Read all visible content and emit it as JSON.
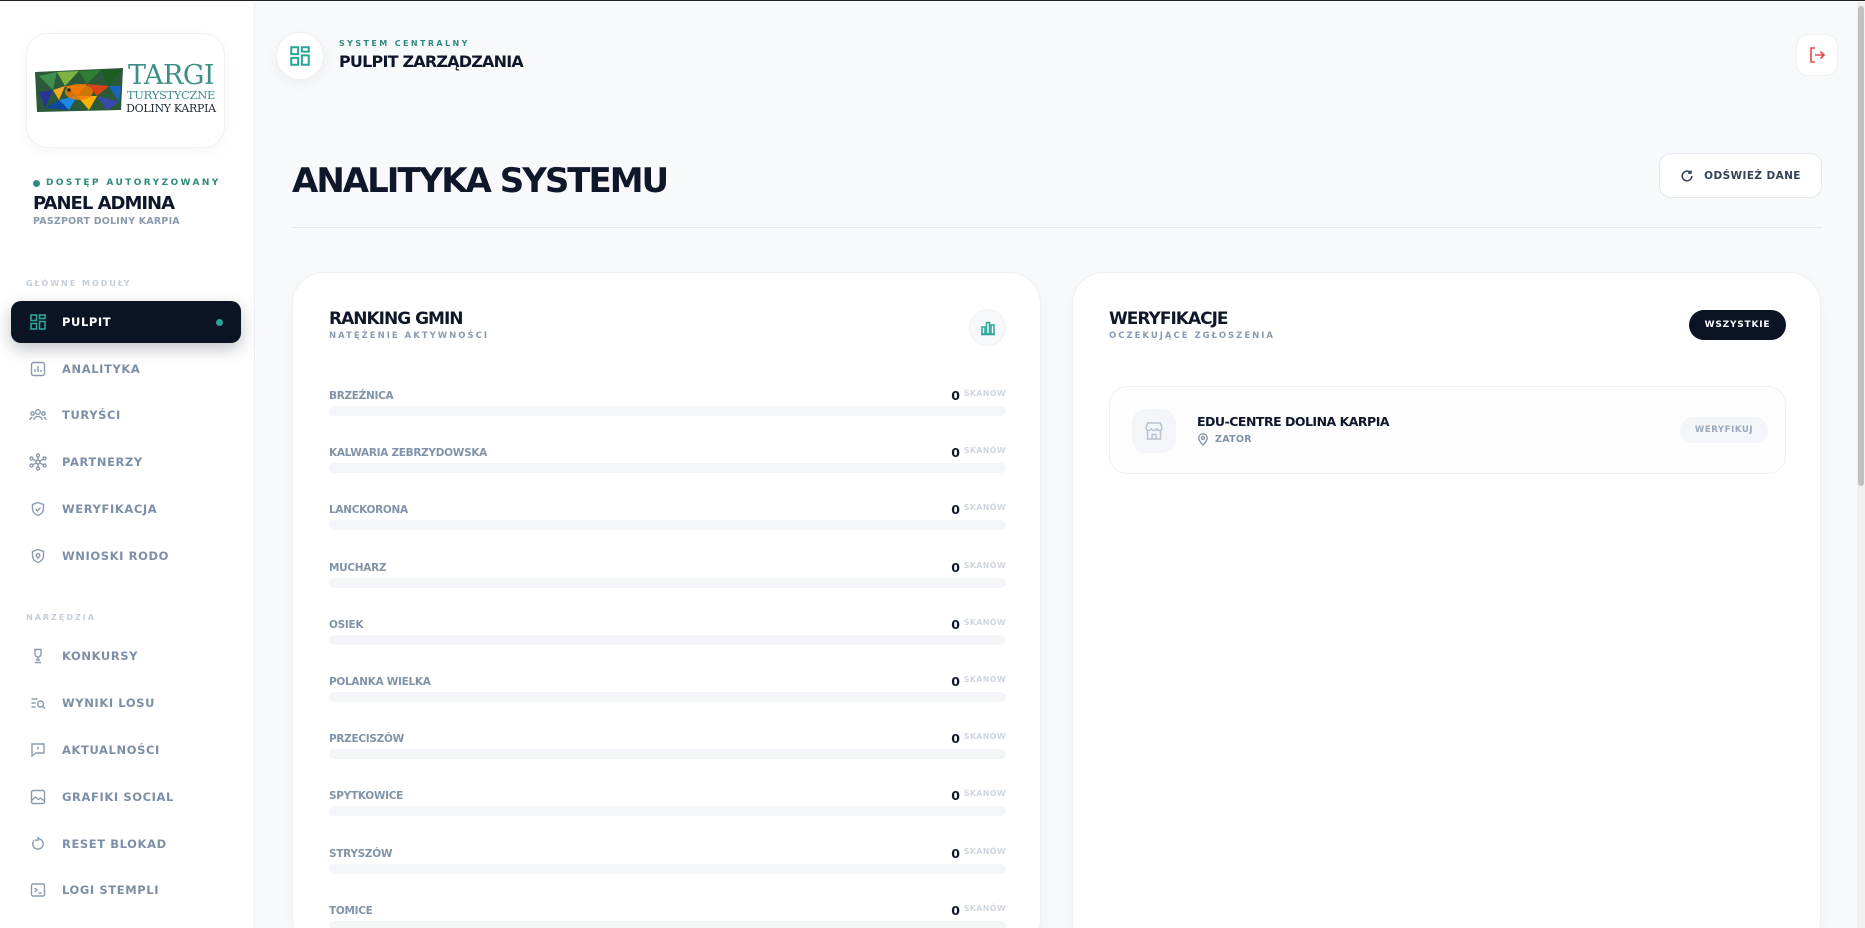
{
  "sidebar": {
    "logo": {
      "line1": "TARGI",
      "line2": "TURYSTYCZNE",
      "line3": "DOLINY KARPIA"
    },
    "auth_label": "DOSTĘP AUTORYZOWANY",
    "title": "PANEL ADMINA",
    "subtitle": "PASZPORT DOLINY KARPIA",
    "section_main": "GŁÓWNE MODUŁY",
    "section_tools": "NARZĘDZIA",
    "items": [
      {
        "label": "PULPIT",
        "icon": "grid-icon",
        "active": true
      },
      {
        "label": "ANALITYKA",
        "icon": "chart-icon"
      },
      {
        "label": "TURYŚCI",
        "icon": "users-icon"
      },
      {
        "label": "PARTNERZY",
        "icon": "network-icon"
      },
      {
        "label": "WERYFIKACJA",
        "icon": "shield-check-icon"
      },
      {
        "label": "WNIOSKI RODO",
        "icon": "shield-lock-icon"
      },
      {
        "label": "KONKURSY",
        "icon": "trophy-icon"
      },
      {
        "label": "WYNIKI LOSU",
        "icon": "list-search-icon"
      },
      {
        "label": "AKTUALNOŚCI",
        "icon": "message-alert-icon"
      },
      {
        "label": "GRAFIKI SOCIAL",
        "icon": "image-icon"
      },
      {
        "label": "RESET BLOKAD",
        "icon": "reset-icon"
      },
      {
        "label": "LOGI STEMPLI",
        "icon": "terminal-icon"
      }
    ]
  },
  "header": {
    "sup": "SYSTEM CENTRALNY",
    "title": "PULPIT ZARZĄDZANIA"
  },
  "page": {
    "title": "ANALITYKA SYSTEMU",
    "refresh_label": "ODŚWIEŻ DANE"
  },
  "ranking": {
    "title": "RANKING GMIN",
    "subtitle": "NATĘŻENIE AKTYWNOŚCI",
    "unit": "SKANÓW",
    "rows": [
      {
        "name": "BRZEŹNICA",
        "value": "0",
        "fill": 0
      },
      {
        "name": "KALWARIA ZEBRZYDOWSKA",
        "value": "0",
        "fill": 0
      },
      {
        "name": "LANCKORONA",
        "value": "0",
        "fill": 0
      },
      {
        "name": "MUCHARZ",
        "value": "0",
        "fill": 0
      },
      {
        "name": "OSIEK",
        "value": "0",
        "fill": 0
      },
      {
        "name": "POLANKA WIELKA",
        "value": "0",
        "fill": 0
      },
      {
        "name": "PRZECISZÓW",
        "value": "0",
        "fill": 0
      },
      {
        "name": "SPYTKOWICE",
        "value": "0",
        "fill": 0
      },
      {
        "name": "STRYSZÓW",
        "value": "0",
        "fill": 0
      },
      {
        "name": "TOMICE",
        "value": "0",
        "fill": 0
      }
    ]
  },
  "verifications": {
    "title": "WERYFIKACJE",
    "subtitle": "OCZEKUJĄCE ZGŁOSZENIA",
    "all_label": "WSZYSTKIE",
    "items": [
      {
        "name": "EDU-CENTRE DOLINA KARPIA",
        "location": "ZATOR",
        "action": "WERYFIKUJ"
      }
    ]
  },
  "colors": {
    "accent": "#2aa597",
    "dark": "#0b1424",
    "logout": "#e5484d"
  }
}
